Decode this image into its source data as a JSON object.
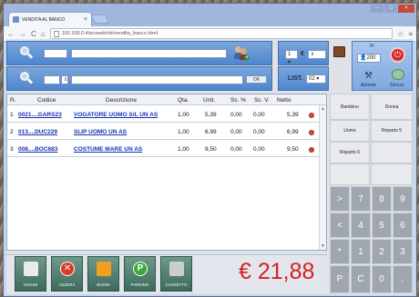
{
  "browser": {
    "tab_title": "VENDITA AL BANCO",
    "tab_close": "×",
    "url": "192.168.0.4/proweb/vb/vendita_banco.html"
  },
  "search": {
    "barcode_value": "",
    "description_value": "",
    "ok_label": "OK"
  },
  "options": {
    "quantity": "1",
    "currency_symbol": "€",
    "listino_label": "LIST.",
    "listino_value": "02"
  },
  "actions": {
    "receipt_count": "200",
    "azione_label": "Azione",
    "sincro_label": "Sincro"
  },
  "table": {
    "headers": [
      "R.",
      "Codice",
      "Descrizione",
      "Qta.",
      "Unit.",
      "Sc. %",
      "Sc. V.",
      "Netto"
    ],
    "rows": [
      {
        "r": "1",
        "codice": "0021....GARS23",
        "descrizione": "VOGATORE UOMO S/L UN AS",
        "qta": "1,00",
        "unit": "5,39",
        "sc_pct": "0,00",
        "sc_v": "0,00",
        "netto": "5,39"
      },
      {
        "r": "2",
        "codice": "013....DUC229",
        "descrizione": "SLIP UOMO UN AS",
        "qta": "1,00",
        "unit": "6,99",
        "sc_pct": "0,00",
        "sc_v": "0,00",
        "netto": "6,99"
      },
      {
        "r": "3",
        "codice": "008....BOC683",
        "descrizione": "COSTUME MARE UN AS",
        "qta": "1,00",
        "unit": "9,50",
        "sc_pct": "0,00",
        "sc_v": "0,00",
        "netto": "9,50"
      }
    ]
  },
  "footer_buttons": [
    {
      "label": "CHIUDI",
      "icon": "cash-register-icon"
    },
    {
      "label": "AZZERA",
      "icon": "cancel-icon"
    },
    {
      "label": "BUONI",
      "icon": "gift-icon"
    },
    {
      "label": "PARKING",
      "icon": "parking-icon"
    },
    {
      "label": "CASSETTO",
      "icon": "drawer-icon"
    }
  ],
  "total": "€ 21,88",
  "departments": {
    "bambino": "Bambino",
    "donna": "Donna",
    "uomo": "Uomo",
    "reparto5": "Reparto 5",
    "reparto6": "Reparto 6"
  },
  "keypad": {
    "row1": [
      ">",
      "7",
      "8",
      "9"
    ],
    "row2": [
      "<",
      "4",
      "5",
      "6"
    ],
    "row3": [
      "*",
      "1",
      "2",
      "3"
    ],
    "row4": [
      "P",
      "C",
      "0",
      "."
    ]
  },
  "colors": {
    "accent_blue": "#4f86cf",
    "total_red": "#d62020",
    "link_blue": "#1530b0"
  }
}
